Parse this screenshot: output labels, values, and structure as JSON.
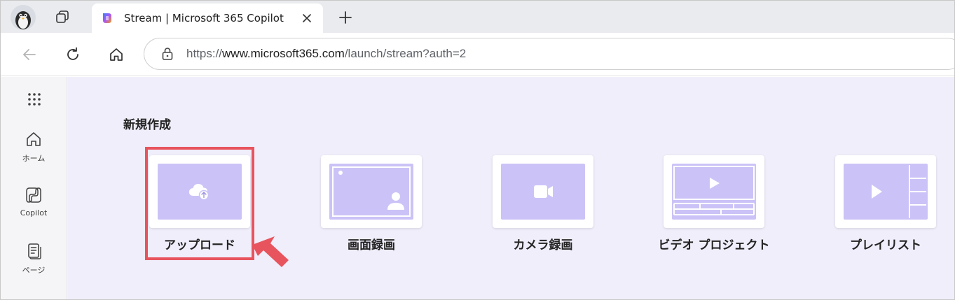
{
  "browser": {
    "tab": {
      "title": "Stream | Microsoft 365 Copilot"
    },
    "address": {
      "prefix": "https://",
      "domain": "www.microsoft365.com",
      "path": "/launch/stream?auth=2"
    }
  },
  "rail": {
    "items": [
      {
        "label": "ホーム",
        "icon": "home-icon"
      },
      {
        "label": "Copilot",
        "icon": "copilot-icon"
      },
      {
        "label": "ページ",
        "icon": "pages-icon"
      }
    ]
  },
  "main": {
    "section_title": "新規作成",
    "cards": [
      {
        "label": "アップロード",
        "icon": "cloud-upload-icon"
      },
      {
        "label": "画面録画",
        "icon": "screen-record-icon"
      },
      {
        "label": "カメラ録画",
        "icon": "camera-icon"
      },
      {
        "label": "ビデオ プロジェクト",
        "icon": "video-project-icon"
      },
      {
        "label": "プレイリスト",
        "icon": "playlist-icon"
      }
    ]
  },
  "colors": {
    "accent": "#cbc3f7",
    "highlight": "#e8545e",
    "background": "#f0eefa"
  }
}
